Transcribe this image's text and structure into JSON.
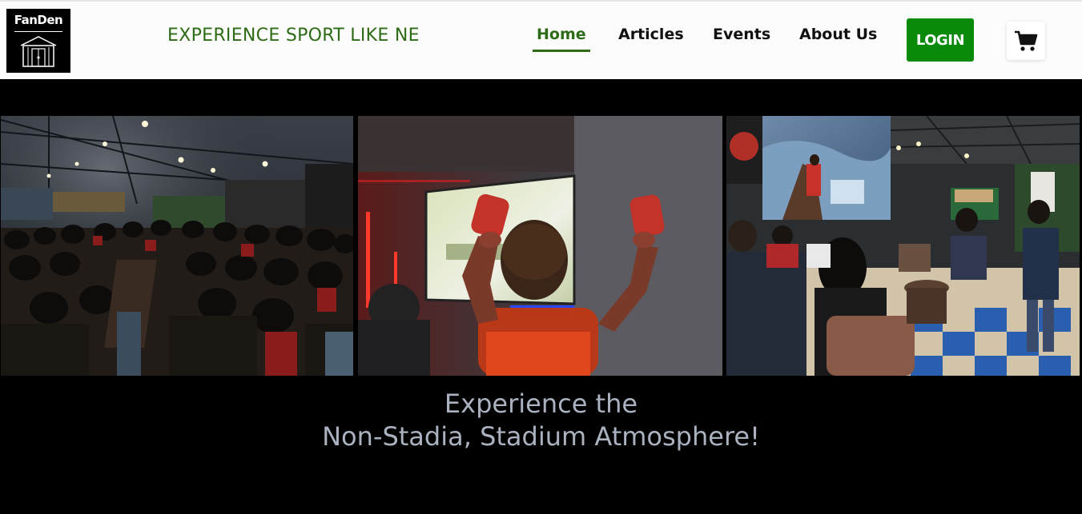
{
  "header": {
    "logo_text": "FanDen",
    "tagline": "EXPERIENCE SPORT LIKE NE",
    "nav": {
      "home": "Home",
      "articles": "Articles",
      "events": "Events",
      "about": "About Us"
    },
    "login_label": "LOGIN",
    "cart_icon": "cart-icon"
  },
  "hero": {
    "heading_line1": "Experience the",
    "heading_line2": "Non-Stadia, Stadium Atmosphere!"
  },
  "colors": {
    "accent_green": "#2e6b16",
    "login_green": "#0a8a0a",
    "hero_bg": "#000000",
    "heading_text": "#aab2c0"
  }
}
